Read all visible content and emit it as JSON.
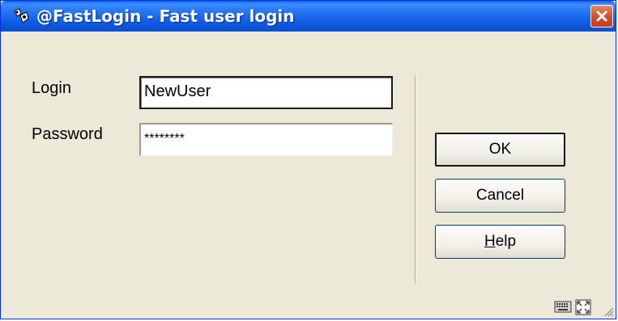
{
  "window": {
    "title": "@FastLogin - Fast user login",
    "icon": "app-logo-icon",
    "close_icon": "close-icon"
  },
  "form": {
    "login_label": "Login",
    "login_value": "NewUser",
    "password_label": "Password",
    "password_value": "********"
  },
  "buttons": {
    "ok_label": "OK",
    "cancel_label": "Cancel",
    "help_label": "Help",
    "help_accelerator": "H"
  },
  "statusbar": {
    "icons": [
      "keyboard-icon",
      "resize-icon",
      "size-grip-icon"
    ]
  },
  "colors": {
    "titlebar": "#0b56de",
    "window_bg": "#ece9d8",
    "close": "#d5502c"
  }
}
